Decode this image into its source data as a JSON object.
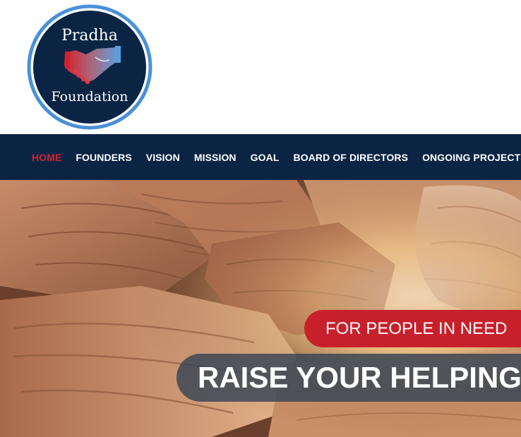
{
  "brand": {
    "name_line1": "Pradha",
    "name_line2": "Foundation",
    "logo_icon": "handshake-icon",
    "ring_color": "#4a90d9",
    "disc_color": "#0b2444"
  },
  "nav": {
    "background": "#0b2444",
    "active_color": "#d2232e",
    "items": [
      {
        "label": "HOME",
        "active": true
      },
      {
        "label": "FOUNDERS"
      },
      {
        "label": "VISION"
      },
      {
        "label": "MISSION"
      },
      {
        "label": "GOAL"
      },
      {
        "label": "BOARD OF DIRECTORS"
      },
      {
        "label": "ONGOING PROJECTS"
      }
    ]
  },
  "hero": {
    "image": "hands-together-photo",
    "tagline": "FOR PEOPLE IN NEED",
    "headline": "RAISE YOUR HELPING HANDS",
    "tagline_bg": "#c8202b",
    "headline_bg": "#374454"
  }
}
